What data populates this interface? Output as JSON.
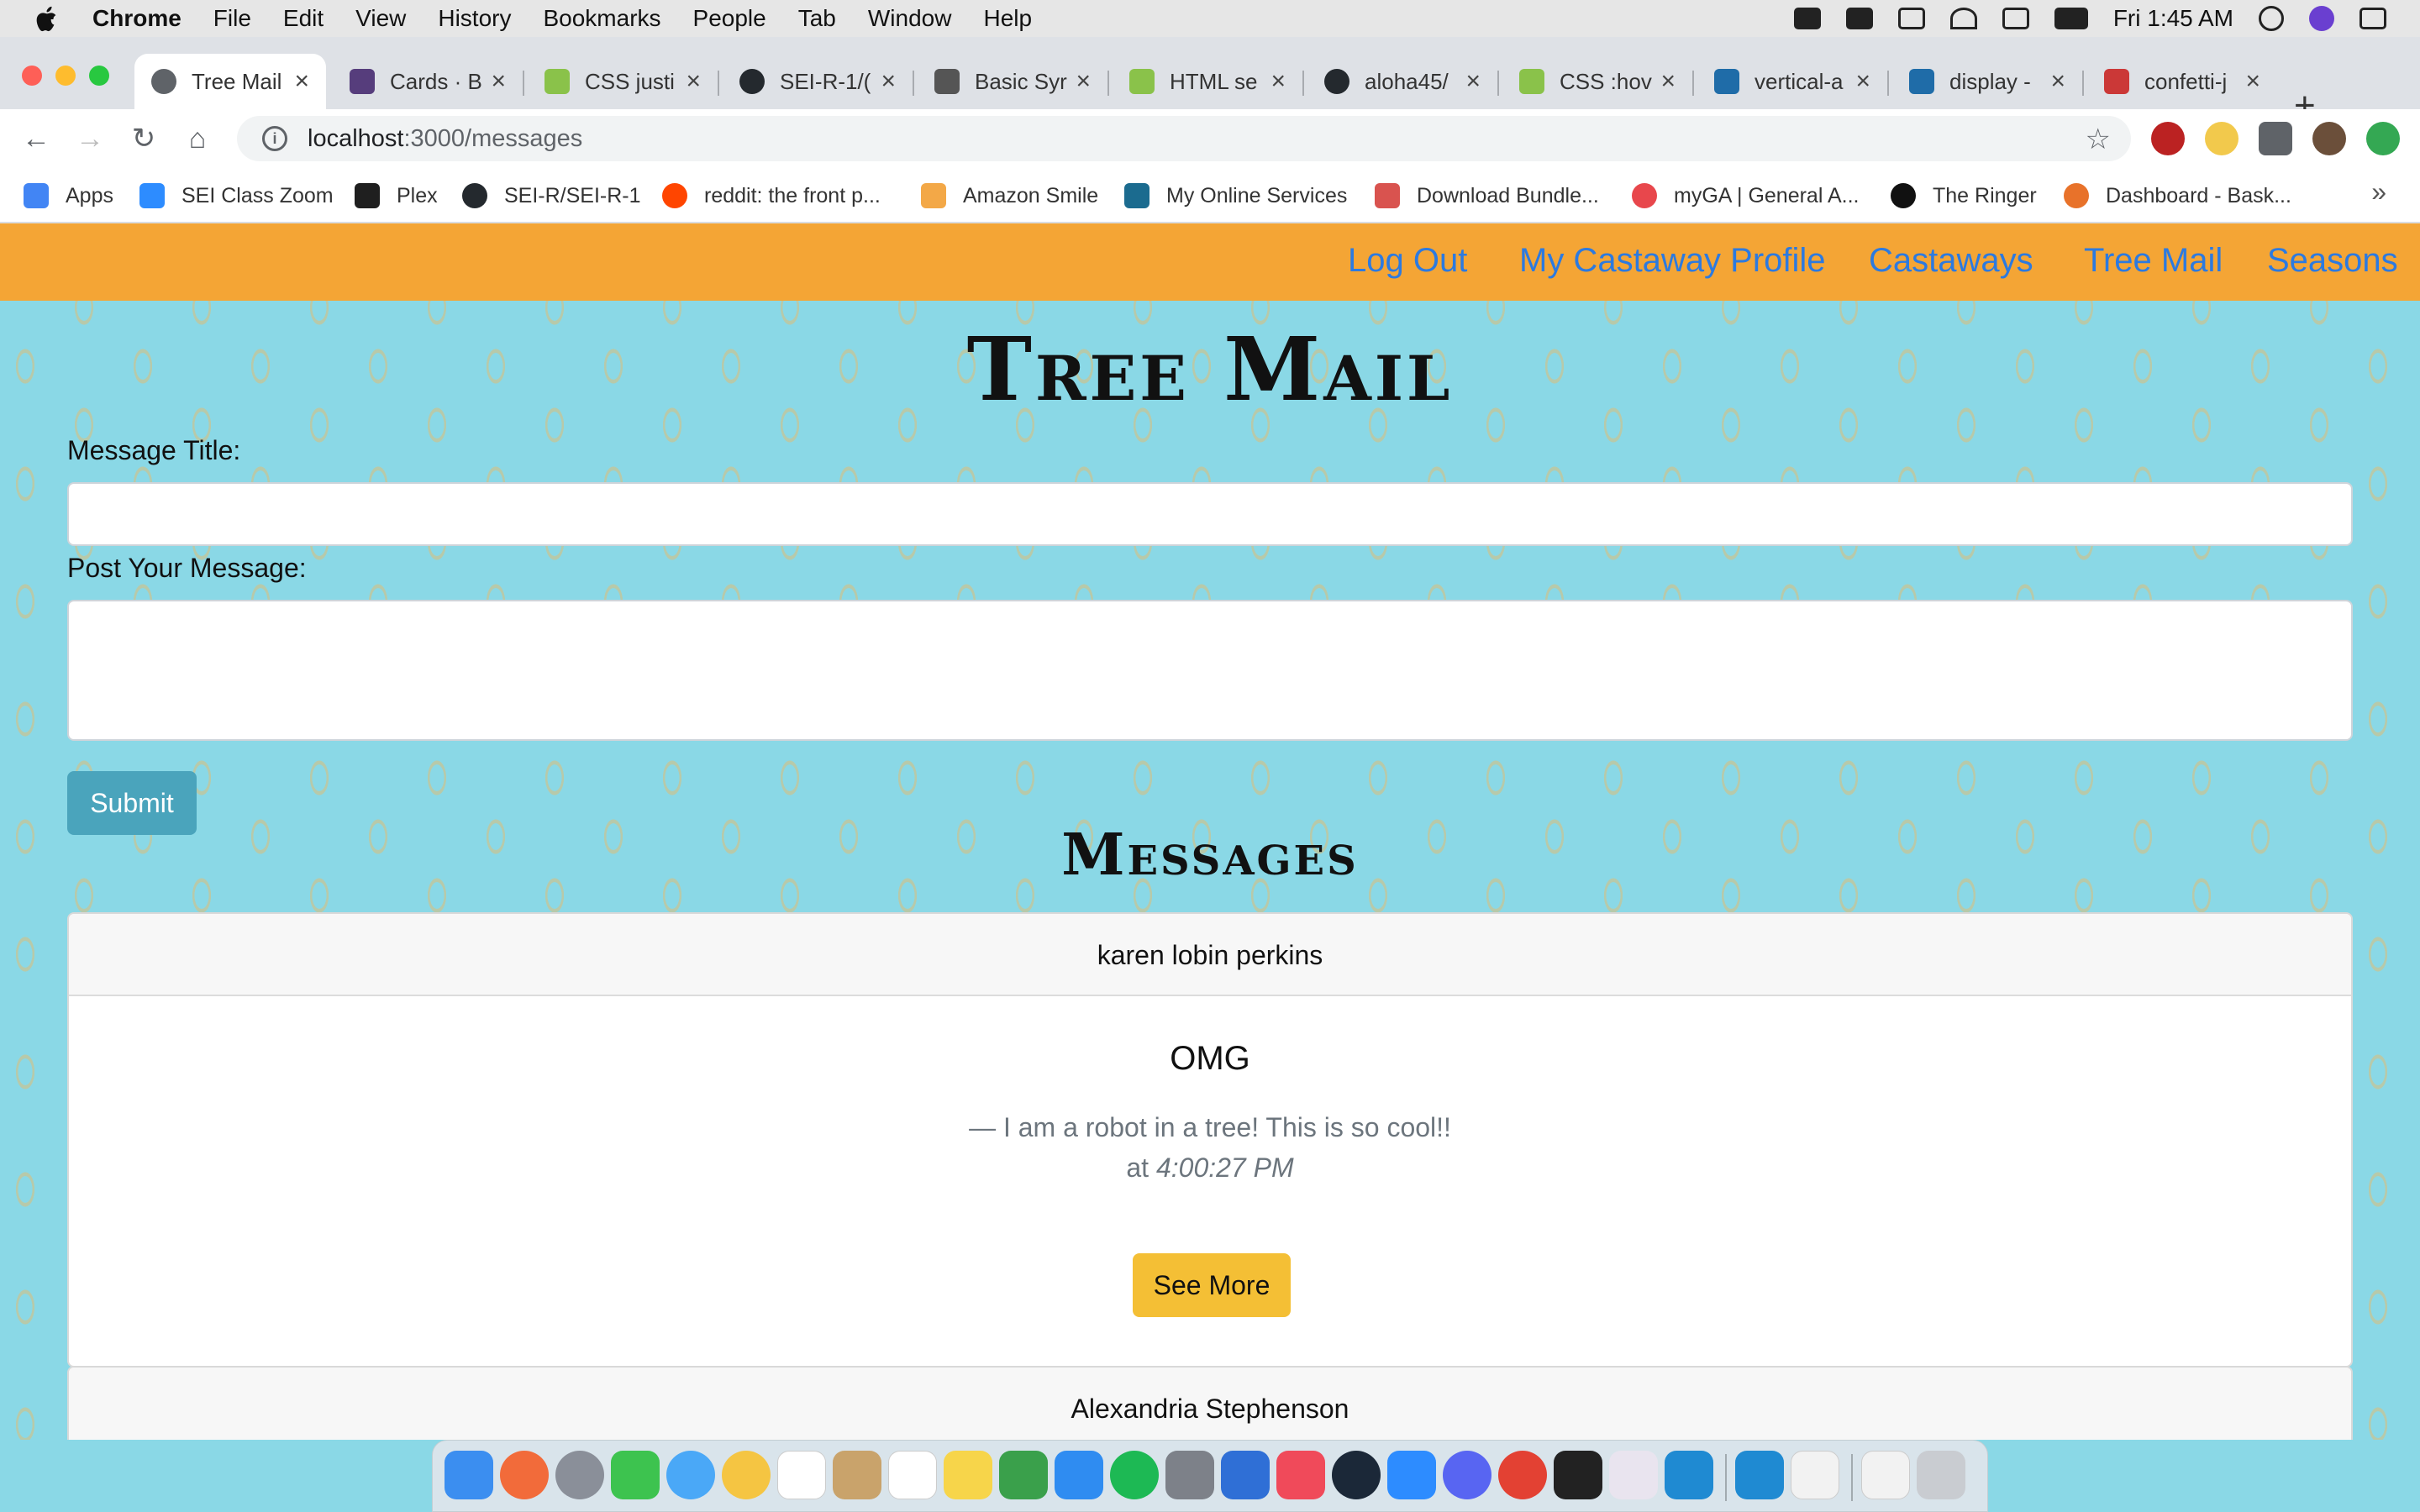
{
  "menubar": {
    "app": "Chrome",
    "items": [
      "File",
      "Edit",
      "View",
      "History",
      "Bookmarks",
      "People",
      "Tab",
      "Window",
      "Help"
    ],
    "clock": "Fri 1:45 AM"
  },
  "tabs": [
    {
      "title": "Tree Mail",
      "favicon": "globe-icon",
      "color": "#5f6368",
      "active": true
    },
    {
      "title": "Cards · B",
      "favicon": "bootstrap-icon",
      "color": "#563d7c"
    },
    {
      "title": "CSS justi",
      "favicon": "w3schools-icon",
      "color": "#8ac24a"
    },
    {
      "title": "SEI-R-1/(",
      "favicon": "github-icon",
      "color": "#24292e"
    },
    {
      "title": "Basic Syr",
      "favicon": "markdown-icon",
      "color": "#555555"
    },
    {
      "title": "HTML se",
      "favicon": "w3schools-icon",
      "color": "#8ac24a"
    },
    {
      "title": "aloha45/",
      "favicon": "github-icon",
      "color": "#24292e"
    },
    {
      "title": "CSS :hov",
      "favicon": "w3schools-icon",
      "color": "#8ac24a"
    },
    {
      "title": "vertical-a",
      "favicon": "mdn-icon",
      "color": "#1f6ca8"
    },
    {
      "title": "display -",
      "favicon": "mdn-icon",
      "color": "#1f6ca8"
    },
    {
      "title": "confetti-j",
      "favicon": "npm-icon",
      "color": "#cb3837"
    }
  ],
  "address": {
    "host": "localhost",
    "path": ":3000/messages"
  },
  "bookmarks": [
    {
      "label": "Apps",
      "icon": "apps-grid-icon",
      "color": "#4285f4"
    },
    {
      "label": "SEI Class Zoom",
      "icon": "zoom-icon",
      "color": "#2d8cff"
    },
    {
      "label": "Plex",
      "icon": "plex-icon",
      "color": "#1f1f1f"
    },
    {
      "label": "SEI-R/SEI-R-1",
      "icon": "github-icon",
      "color": "#24292e"
    },
    {
      "label": "reddit: the front p...",
      "icon": "reddit-icon",
      "color": "#ff4500"
    },
    {
      "label": "Amazon Smile",
      "icon": "amazon-icon",
      "color": "#f3a847"
    },
    {
      "label": "My Online Services",
      "icon": "services-icon",
      "color": "#1b6b8f"
    },
    {
      "label": "Download Bundle...",
      "icon": "bundle-icon",
      "color": "#d9534f"
    },
    {
      "label": "myGA | General A...",
      "icon": "ga-icon",
      "color": "#e8474c"
    },
    {
      "label": "The Ringer",
      "icon": "ringer-icon",
      "color": "#111111"
    },
    {
      "label": "Dashboard - Bask...",
      "icon": "basketball-icon",
      "color": "#e8722a"
    }
  ],
  "site_nav": [
    "Log Out",
    "My Castaway Profile",
    "Castaways",
    "Tree Mail",
    "Seasons"
  ],
  "page": {
    "title": "Tree Mail",
    "message_title_label": "Message Title:",
    "message_body_label": "Post Your Message:",
    "submit_label": "Submit",
    "messages_heading": "Messages"
  },
  "messages": [
    {
      "author": "karen lobin perkins",
      "title": "OMG",
      "body": "— I am a robot in a tree! This is so cool!!",
      "time_prefix": "at",
      "time": "4:00:27 PM",
      "button": "See More"
    },
    {
      "author": "Alexandria Stephenson"
    }
  ],
  "colors": {
    "navbar": "#f4a535",
    "page_bg": "#8ad8e6",
    "link": "#2c7ae0",
    "submit": "#4aa4bc",
    "see_more": "#f4bf35"
  }
}
